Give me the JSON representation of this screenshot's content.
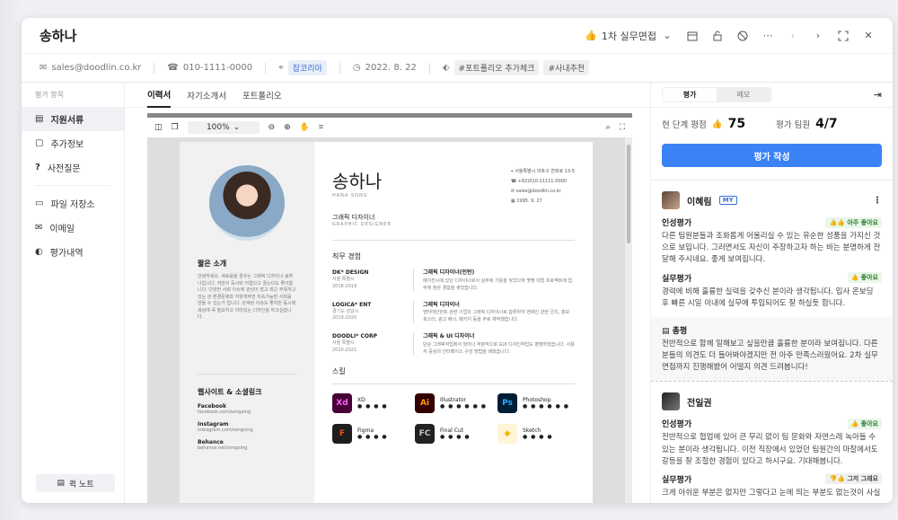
{
  "candidate": {
    "name": "송하나"
  },
  "header": {
    "stage_label": "1차 실무면접"
  },
  "info": {
    "email": "sales@doodlin.co.kr",
    "phone": "010-1111-0000",
    "source": "잡코리아",
    "date": "2022. 8. 22",
    "tags": [
      "#포트폴리오 추가체크",
      "#사내추천"
    ]
  },
  "sidebar": {
    "section_label": "평가 항목",
    "items": [
      {
        "label": "지원서류",
        "icon": "document-icon"
      },
      {
        "label": "추가정보",
        "icon": "clipboard-icon"
      },
      {
        "label": "사전질문",
        "icon": "question-icon"
      },
      {
        "label": "파일 저장소",
        "icon": "storage-icon"
      },
      {
        "label": "이메일",
        "icon": "mail-icon"
      },
      {
        "label": "평가내역",
        "icon": "history-icon"
      }
    ],
    "quick_note": "퀵 노트"
  },
  "doc_tabs": [
    "이력서",
    "자기소개서",
    "포트폴리오"
  ],
  "viewer": {
    "zoom": "100%"
  },
  "resume": {
    "name": "송하나",
    "name_en": "HANA SONG",
    "role": "그래픽 디자이너",
    "role_en": "GRAPHIC DESIGNER",
    "contact": [
      "서울특별시 마포구 연희로 13-5",
      "+82)010-11111-0000",
      "sales@doodlin.co.kr",
      "1995. 9. 27"
    ],
    "intro_title": "짧은 소개",
    "intro_text": "안녕하세요. 새로움을 꿈꾸는 그래픽 디자이너 송하나입니다. 저만의 독사와 어렵다고 끊는다도 좋아합니다. 다양한 사회 이슈에 관심이 많고 최근 주목하고있는 관 환경문제와 지렇게하면 지속가능한 사회를 만들 수 있는가 입니다. 관계된 이슈도 좋지만 동시에 세상에 꼭 필요하고 의미있는 디자인을 하고싶습니다.",
    "links_title": "웹사이트 & 소셜링크",
    "links": [
      {
        "name": "Facebook",
        "url": "facebook.com/songsing"
      },
      {
        "name": "Instagram",
        "url": "instagram.com/songsing"
      },
      {
        "name": "Behance",
        "url": "behance.net/songsing"
      }
    ],
    "exp_title": "직무 경험",
    "experience": [
      {
        "company": "DK* DESIGN",
        "loc": "서울 특별시",
        "period": "2018-2019",
        "title": "그래픽 디자이너(인턴)",
        "desc": "에이전시에 있던 디자이너로서 실무에 기틀을 닦았으며 몇몇 대형 프로젝트에 업무에 참관 경험을 쌓았습니다."
      },
      {
        "company": "LOGICA* ENT",
        "loc": "경기도 성남시",
        "period": "2019-2020",
        "title": "그래픽 디자이너",
        "desc": "엔터테인먼트 관련 기업의 그래픽 디자이너로 합류하여 엔에인 관련 굿즈, 홍보 포스터, 광고 배너, 패키지 등을 주로 제작했습니다."
      },
      {
        "company": "DOODLI* CORP",
        "loc": "서울 특별시",
        "period": "2020-2021",
        "title": "그래픽 & UI 디자이너",
        "desc": "단순 그래픽작업에서 벗어나 부분적으로 GUI 디자인작업도 병행하였습니다. 사용자 중심의 인터페이스 구성 방법을 배웠습니다."
      }
    ],
    "skills_title": "스킬",
    "skills": [
      {
        "name": "XD",
        "abbr": "Xd",
        "color": "#470137",
        "fg": "#ff61f6",
        "dots": "● ● ● ●"
      },
      {
        "name": "Illustrator",
        "abbr": "Ai",
        "color": "#330000",
        "fg": "#ff9a00",
        "dots": "● ● ● ● ● ●"
      },
      {
        "name": "Photoshop",
        "abbr": "Ps",
        "color": "#001e36",
        "fg": "#31a8ff",
        "dots": "● ● ● ● ● ●"
      },
      {
        "name": "Figma",
        "abbr": "F",
        "color": "#1e1e1e",
        "fg": "#f24e1e",
        "dots": "● ● ● ●"
      },
      {
        "name": "Final Cut",
        "abbr": "FC",
        "color": "#222",
        "fg": "#c8c8c8",
        "dots": "● ● ● ●"
      },
      {
        "name": "Sketch",
        "abbr": "◆",
        "color": "#fff4d6",
        "fg": "#f7b500",
        "dots": "● ● ● ●"
      }
    ]
  },
  "panel": {
    "tabs": [
      "평가",
      "메모"
    ],
    "avg_label": "현 단계 평점",
    "avg_score": "75",
    "raters_label": "평가 팀원",
    "raters": "4/7",
    "write_btn": "평가 작성",
    "reviews": [
      {
        "name": "이혜림",
        "mine": "MY",
        "evals": [
          {
            "label": "인성평가",
            "badge": "아주 좋아요",
            "text": "다른 팀원분들과 조화롭게 어울리실 수 있는 유순한 성품을 가지신 것으로 보입니다. 그러면서도 자신이 주장하고자 하는 바는 분명하게 전달해 주시네요. 좋게 보여집니다."
          },
          {
            "label": "실무평가",
            "badge": "좋아요",
            "text": "경력에 비해 훌륭한 실력을 갖추신 분이라 생각됩니다. 입사 온보딩 후 빠른 시일 이내에 실무에 투입되어도 잘 하실듯 합니다."
          }
        ],
        "total_label": "총평",
        "total": "전반적으로 함께 일해보고 싶을만큼 훌륭한 분이라 보여집니다. 다른 분들의 의견도 더 들어봐야겠지만 전 아주 만족스러웠어요. 2차 실무면접까지 진행해봤어 어떨지 의견 드려봅니다!"
      },
      {
        "name": "전일권",
        "evals": [
          {
            "label": "인성평가",
            "badge": "좋아요",
            "text": "전반적으로 협업에 있어 큰 무리 없이 팀 문화와 자연스레 녹아들 수 있는 분이라 생각됩니다. 이전 직장에서 있었던 팀원간의 마찰에서도 갈등을 잘 조절한 경험이 있다고 하시구요. 기대해봅니다."
          },
          {
            "label": "실무평가",
            "badge": "그저 그래요",
            "text": "크게 아쉬운 부분은 없지만 그렇다고 눈에 띄는 부분도 없는것이 사실"
          }
        ]
      }
    ]
  }
}
